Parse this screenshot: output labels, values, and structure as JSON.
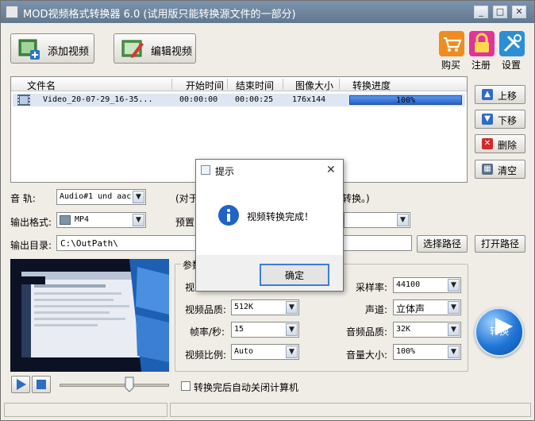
{
  "window": {
    "title": "MOD视频格式转换器 6.0 (试用版只能转换源文件的一部分)"
  },
  "toolbar": {
    "add_video": "添加视频",
    "edit_video": "编辑视频",
    "buy": "购买",
    "register": "注册",
    "settings": "设置"
  },
  "list": {
    "columns": [
      "文件名",
      "开始时间",
      "结束时间",
      "图像大小",
      "转换进度"
    ],
    "rows": [
      {
        "filename": "Video_20-07-29_16-35...",
        "start": "00:00:00",
        "end": "00:00:25",
        "size": "176x144",
        "progress_text": "100%",
        "progress": 1.0
      }
    ]
  },
  "side": {
    "up": "上移",
    "down": "下移",
    "delete": "删除",
    "clear": "清空"
  },
  "audio": {
    "label": "音    轨:",
    "value": "Audio#1 und aac",
    "hint_left": "(对于",
    "hint_right": "转换。)"
  },
  "output": {
    "format_label": "输出格式:",
    "format_value": "MP4",
    "preset_label": "预置",
    "dir_label": "输出目录:",
    "dir_value": "C:\\OutPath\\",
    "choose_path": "选择路径",
    "open_path": "打开路径"
  },
  "params": {
    "group_label": "参数",
    "video_label": "视",
    "video_quality_label": "视频品质:",
    "video_quality": "512K",
    "fps_label": "帧率/秒:",
    "fps": "15",
    "aspect_label": "视频比例:",
    "aspect": "Auto",
    "sample_label": "采样率:",
    "sample": "44100",
    "channel_label": "声道:",
    "channel": "立体声",
    "audio_quality_label": "音频品质:",
    "audio_quality": "32K",
    "volume_label": "音量大小:",
    "volume": "100%"
  },
  "convert": {
    "label": "转换"
  },
  "shutdown": {
    "label": "转换完后自动关闭计算机"
  },
  "player": {
    "seek": 0.65
  },
  "dialog": {
    "title": "提示",
    "message": "视频转换完成！",
    "ok": "确定"
  },
  "colors": {
    "accent": "#2d6dd0",
    "titlebar": "#6d839b"
  }
}
